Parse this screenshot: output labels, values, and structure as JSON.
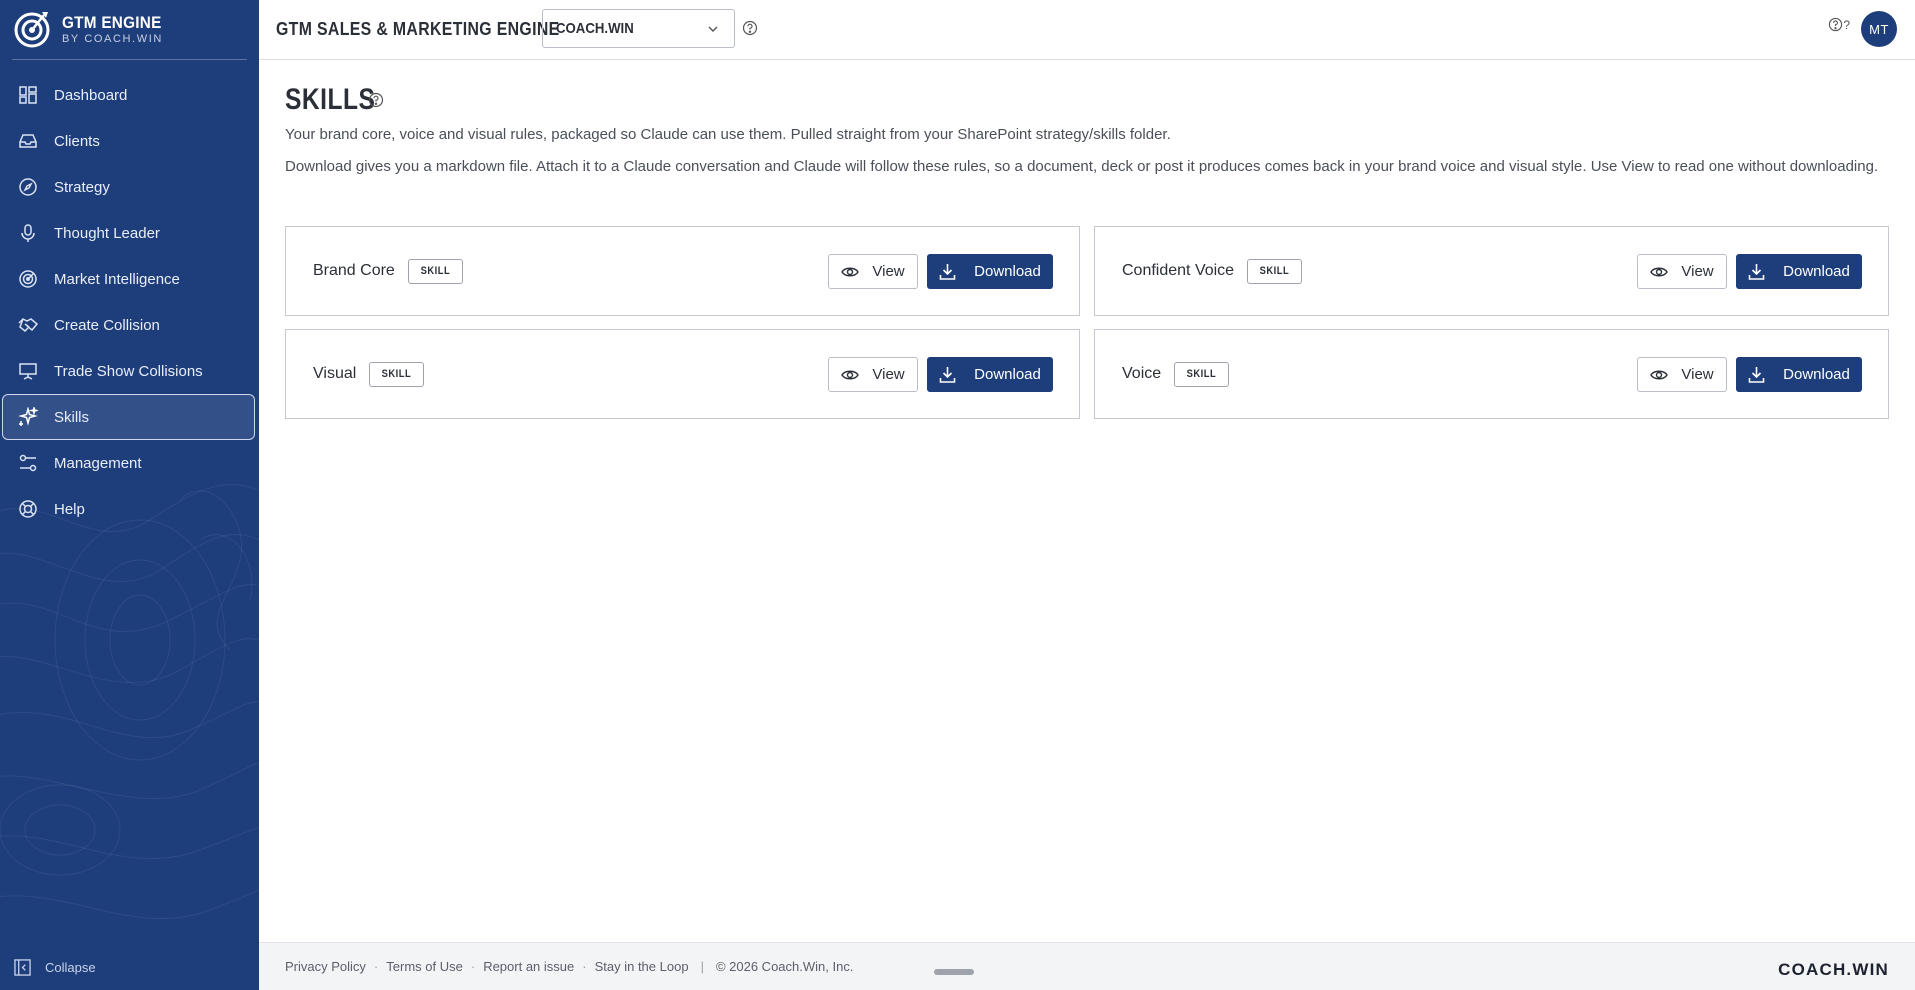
{
  "brand": {
    "title": "GTM ENGINE",
    "subtitle": "BY COACH.WIN"
  },
  "sidebar": {
    "items": [
      {
        "label": "Dashboard",
        "icon": "dashboard-icon"
      },
      {
        "label": "Clients",
        "icon": "inbox-icon"
      },
      {
        "label": "Strategy",
        "icon": "compass-icon"
      },
      {
        "label": "Thought Leader",
        "icon": "microphone-icon"
      },
      {
        "label": "Market Intelligence",
        "icon": "radar-icon"
      },
      {
        "label": "Create Collision",
        "icon": "handshake-icon"
      },
      {
        "label": "Trade Show Collisions",
        "icon": "presentation-icon"
      },
      {
        "label": "Skills",
        "icon": "sparkles-icon",
        "active": true
      },
      {
        "label": "Management",
        "icon": "sliders-icon"
      },
      {
        "label": "Help",
        "icon": "lifebuoy-icon"
      }
    ],
    "collapse_label": "Collapse"
  },
  "header": {
    "app_title": "GTM SALES & MARKETING ENGINE",
    "client_selected": "COACH.WIN",
    "help_text": "?",
    "avatar_initials": "MT"
  },
  "main": {
    "title": "SKILLS",
    "description_1": "Your brand core, voice and visual rules, packaged so Claude can use them. Pulled straight from your SharePoint strategy/skills folder.",
    "description_2": "Download gives you a markdown file. Attach it to a Claude conversation and Claude will follow these rules, so a document, deck or post it produces comes back in your brand voice and visual style. Use View to read one without downloading.",
    "view_label": "View",
    "download_label": "Download",
    "skills": [
      {
        "name": "Brand Core",
        "badge": "SKILL"
      },
      {
        "name": "Confident Voice",
        "badge": "SKILL"
      },
      {
        "name": "Visual",
        "badge": "SKILL"
      },
      {
        "name": "Voice",
        "badge": "SKILL"
      }
    ]
  },
  "footer": {
    "links": [
      "Privacy Policy",
      "Terms of Use",
      "Report an issue",
      "Stay in the Loop"
    ],
    "separator": "·",
    "divider": "|",
    "copyright": "© 2026 Coach.Win, Inc.",
    "logo_text": "COACH.WIN"
  },
  "colors": {
    "brand_navy": "#1e3d7b",
    "border": "#c6c9d0",
    "footer_bg": "#f3f4f6"
  }
}
